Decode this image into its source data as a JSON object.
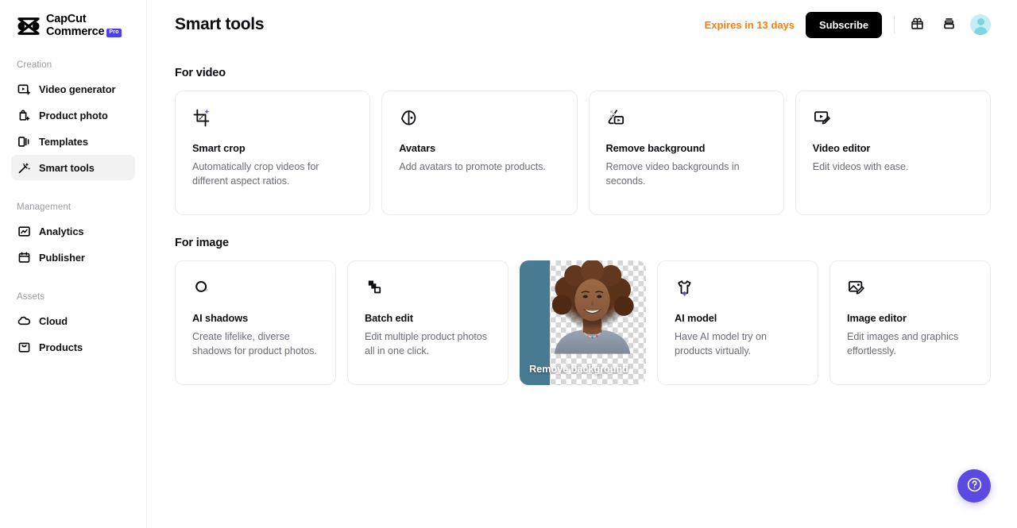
{
  "sidebar": {
    "logo": {
      "line1": "CapCut",
      "line2": "Commerce",
      "badge": "Pro"
    },
    "groups": [
      {
        "label": "Creation",
        "items": [
          {
            "label": "Video generator",
            "icon": "video-generator-icon",
            "active": false
          },
          {
            "label": "Product photo",
            "icon": "product-photo-icon",
            "active": false
          },
          {
            "label": "Templates",
            "icon": "templates-icon",
            "active": false
          },
          {
            "label": "Smart tools",
            "icon": "smart-tools-icon",
            "active": true
          }
        ]
      },
      {
        "label": "Management",
        "items": [
          {
            "label": "Analytics",
            "icon": "analytics-icon",
            "active": false
          },
          {
            "label": "Publisher",
            "icon": "publisher-icon",
            "active": false
          }
        ]
      },
      {
        "label": "Assets",
        "items": [
          {
            "label": "Cloud",
            "icon": "cloud-icon",
            "active": false
          },
          {
            "label": "Products",
            "icon": "products-icon",
            "active": false
          }
        ]
      }
    ]
  },
  "header": {
    "title": "Smart tools",
    "expires_text": "Expires in 13 days",
    "expires_color": "#f7800b",
    "subscribe_label": "Subscribe",
    "gift_icon": "gift-icon",
    "stack_icon": "stack-icon",
    "avatar_icon": "avatar"
  },
  "sections": [
    {
      "title": "For video",
      "cards": [
        {
          "title": "Smart crop",
          "desc": "Automatically crop videos for different aspect ratios.",
          "icon": "smart-crop-icon",
          "type": "icon"
        },
        {
          "title": "Avatars",
          "desc": "Add avatars to promote products.",
          "icon": "avatars-icon",
          "type": "icon"
        },
        {
          "title": "Remove background",
          "desc": "Remove video backgrounds in seconds.",
          "icon": "remove-background-video-icon",
          "type": "icon"
        },
        {
          "title": "Video editor",
          "desc": "Edit videos with ease.",
          "icon": "video-editor-icon",
          "type": "icon"
        }
      ]
    },
    {
      "title": "For image",
      "cards": [
        {
          "title": "AI shadows",
          "desc": "Create lifelike, diverse shadows for product photos.",
          "icon": "ai-shadows-icon",
          "type": "icon"
        },
        {
          "title": "Batch edit",
          "desc": "Edit multiple product photos all in one click.",
          "icon": "batch-edit-icon",
          "type": "icon"
        },
        {
          "title": "Remove background",
          "desc": "",
          "icon": "",
          "type": "photo"
        },
        {
          "title": "AI model",
          "desc": "Have AI model try on products virtually.",
          "icon": "ai-model-icon",
          "type": "icon"
        },
        {
          "title": "Image editor",
          "desc": "Edit images and graphics effortlessly.",
          "icon": "image-editor-icon",
          "type": "icon"
        }
      ]
    }
  ],
  "help": {
    "icon": "help-question-icon",
    "color": "#5b4ae0"
  }
}
